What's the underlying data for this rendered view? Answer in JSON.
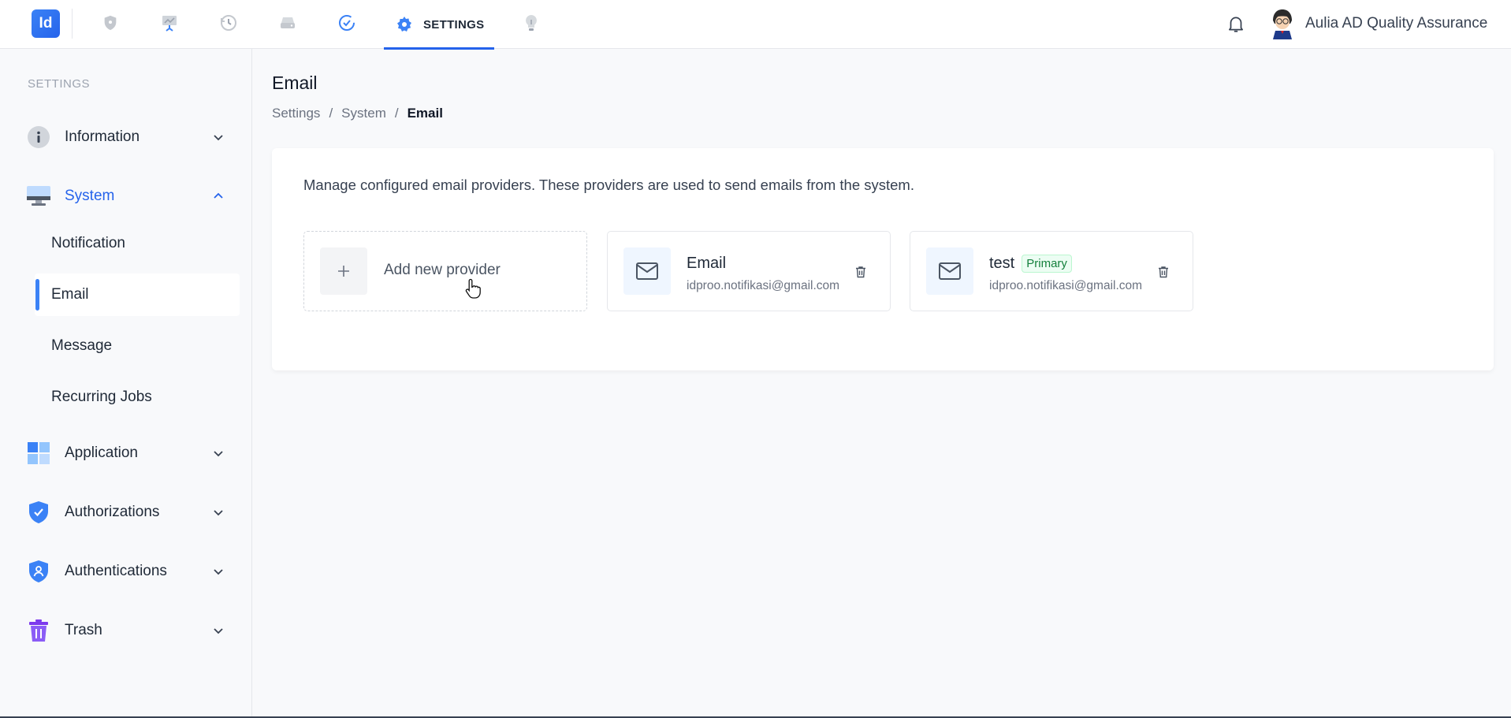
{
  "app": {
    "logo_text": "Id"
  },
  "topnav": {
    "active_label": "SETTINGS",
    "icons": [
      "shield-icon",
      "presentation-icon",
      "history-icon",
      "drive-icon",
      "check-circle-icon",
      "settings-gear-icon",
      "lightbulb-icon"
    ]
  },
  "user": {
    "name": "Aulia AD Quality Assurance"
  },
  "sidebar": {
    "heading": "SETTINGS",
    "items": [
      {
        "label": "Information",
        "icon": "info-icon"
      },
      {
        "label": "System",
        "icon": "monitor-icon",
        "expanded": true
      },
      {
        "label": "Application",
        "icon": "grid-icon"
      },
      {
        "label": "Authorizations",
        "icon": "shield-check-icon"
      },
      {
        "label": "Authentications",
        "icon": "shield-user-icon"
      },
      {
        "label": "Trash",
        "icon": "trash-icon"
      }
    ],
    "system_sub": [
      "Notification",
      "Email",
      "Message",
      "Recurring Jobs"
    ],
    "active_sub": "Email"
  },
  "page": {
    "title": "Email",
    "breadcrumb": [
      "Settings",
      "System",
      "Email"
    ],
    "description": "Manage configured email providers. These providers are used to send emails from the system."
  },
  "providers": {
    "add_label": "Add new provider",
    "items": [
      {
        "name": "Email",
        "email": "idproo.notifikasi@gmail.com",
        "badge": ""
      },
      {
        "name": "test",
        "email": "idproo.notifikasi@gmail.com",
        "badge": "Primary"
      }
    ]
  },
  "colors": {
    "accent": "#2563eb",
    "primary_badge": "#15803d"
  }
}
